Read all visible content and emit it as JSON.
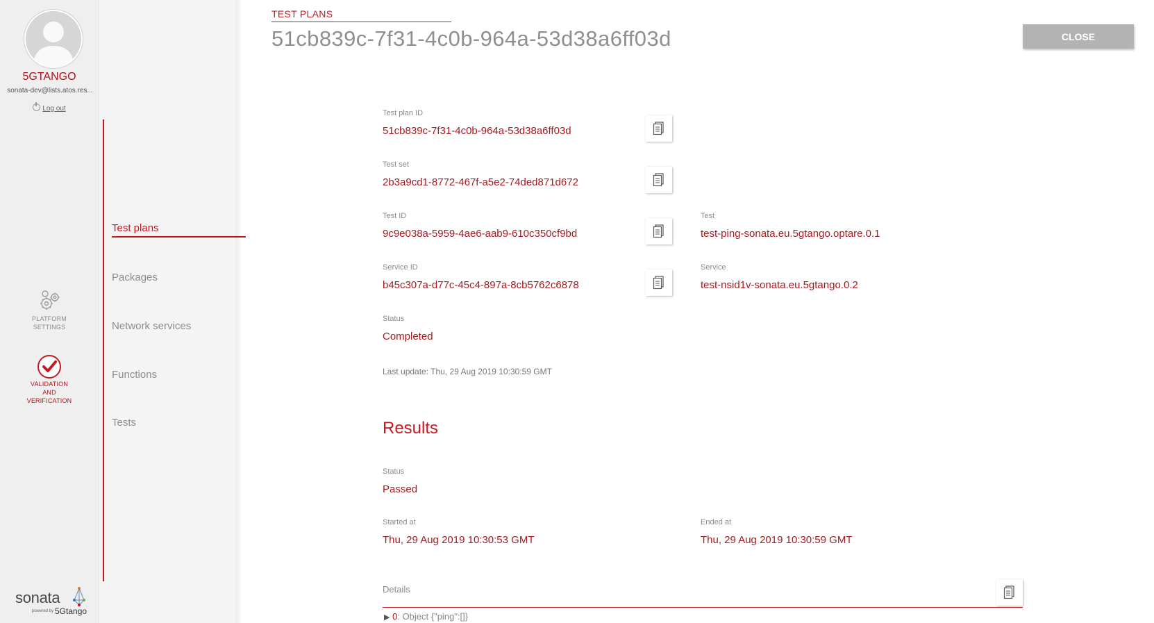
{
  "user": {
    "name": "5GTANGO",
    "email": "sonata-dev@lists.atos.res...",
    "logout_label": "Log out"
  },
  "rail": {
    "platform_settings": [
      "PLATFORM",
      "SETTINGS"
    ],
    "validation": [
      "VALIDATION",
      "AND",
      "VERIFICATION"
    ]
  },
  "logo": {
    "word": "sonata",
    "powered_by": "powered by",
    "brand": "5Gtango"
  },
  "subnav": {
    "items": [
      "Test plans",
      "Packages",
      "Network services",
      "Functions",
      "Tests"
    ],
    "active": "Test plans"
  },
  "header": {
    "breadcrumb": "TEST PLANS",
    "title": "51cb839c-7f31-4c0b-964a-53d38a6ff03d",
    "close_label": "CLOSE"
  },
  "fields": {
    "test_plan_id": {
      "label": "Test plan ID",
      "value": "51cb839c-7f31-4c0b-964a-53d38a6ff03d"
    },
    "test_set": {
      "label": "Test set",
      "value": "2b3a9cd1-8772-467f-a5e2-74ded871d672"
    },
    "test_id": {
      "label": "Test ID",
      "value": "9c9e038a-5959-4ae6-aab9-610c350cf9bd"
    },
    "test": {
      "label": "Test",
      "value": "test-ping-sonata.eu.5gtango.optare.0.1"
    },
    "service_id": {
      "label": "Service ID",
      "value": "b45c307a-d77c-45c4-897a-8cb5762c6878"
    },
    "service": {
      "label": "Service",
      "value": "test-nsid1v-sonata.eu.5gtango.0.2"
    },
    "status": {
      "label": "Status",
      "value": "Completed"
    },
    "last_update": "Last update: Thu, 29 Aug 2019 10:30:59 GMT"
  },
  "results": {
    "title": "Results",
    "status": {
      "label": "Status",
      "value": "Passed"
    },
    "started": {
      "label": "Started at",
      "value": "Thu, 29 Aug 2019 10:30:53 GMT"
    },
    "ended": {
      "label": "Ended at",
      "value": "Thu, 29 Aug 2019 10:30:59 GMT"
    },
    "details_label": "Details",
    "details_row": {
      "caret": "▶",
      "key": "0",
      "rest": ": Object {\"ping\":[]}"
    }
  },
  "colors": {
    "accent": "#c9171e",
    "value": "#a31b21",
    "close_bg": "#b3b3b3"
  },
  "icons": [
    "user-avatar-icon",
    "power-icon",
    "gears-icon",
    "check-circle-icon",
    "copy-icon"
  ]
}
